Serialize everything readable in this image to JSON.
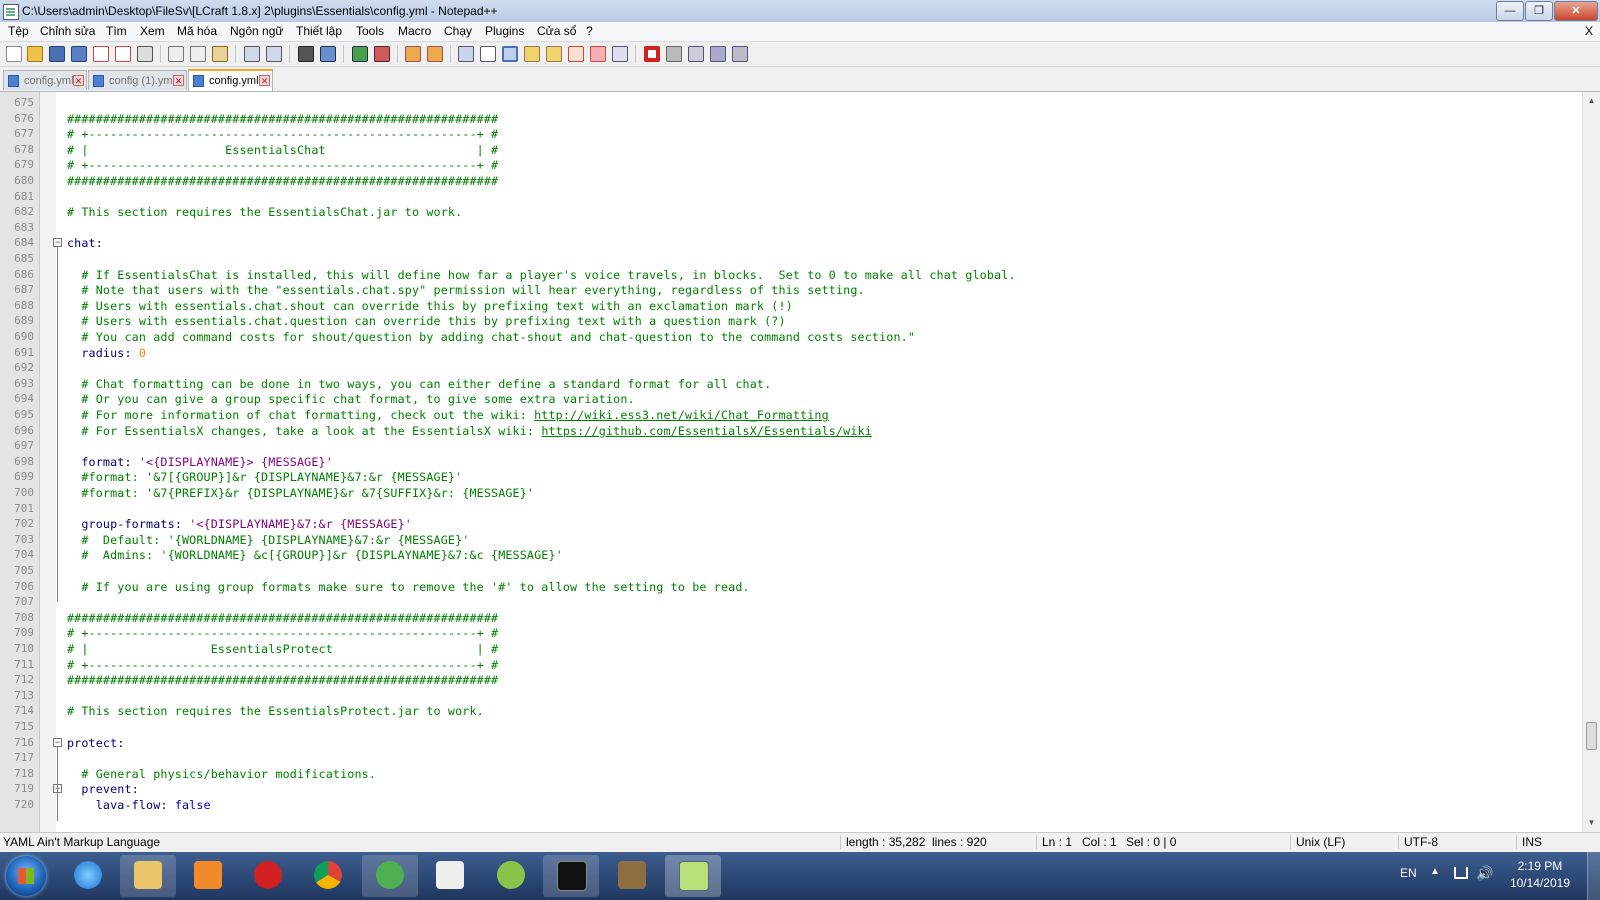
{
  "window": {
    "title": "C:\\Users\\admin\\Desktop\\FileSv\\[LCraft 1.8.x] 2\\plugins\\Essentials\\config.yml - Notepad++",
    "minimize_label": "—",
    "maximize_label": "❐",
    "close_label": "✕"
  },
  "menu": [
    {
      "label": "Tệp"
    },
    {
      "label": "Chỉnh sửa"
    },
    {
      "label": "Tìm"
    },
    {
      "label": "Xem"
    },
    {
      "label": "Mã hóa"
    },
    {
      "label": "Ngôn ngữ"
    },
    {
      "label": "Thiết lập"
    },
    {
      "label": "Tools"
    },
    {
      "label": "Macro"
    },
    {
      "label": "Chạy"
    },
    {
      "label": "Plugins"
    },
    {
      "label": "Cửa sổ"
    },
    {
      "label": "?"
    }
  ],
  "menu_close": "X",
  "tabs": [
    {
      "label": "config.yml",
      "active": false
    },
    {
      "label": "config (1).yml",
      "active": false
    },
    {
      "label": "config.yml",
      "active": true
    }
  ],
  "tab_close_glyph": "✕",
  "editor": {
    "lines": [
      {
        "n": "675",
        "segs": []
      },
      {
        "n": "676",
        "segs": [
          {
            "t": "############################################################",
            "c": "comment"
          }
        ]
      },
      {
        "n": "677",
        "segs": [
          {
            "t": "# +------------------------------------------------------+ #",
            "c": "comment"
          }
        ]
      },
      {
        "n": "678",
        "segs": [
          {
            "t": "# |                   EssentialsChat                     | #",
            "c": "comment"
          }
        ]
      },
      {
        "n": "679",
        "segs": [
          {
            "t": "# +------------------------------------------------------+ #",
            "c": "comment"
          }
        ]
      },
      {
        "n": "680",
        "segs": [
          {
            "t": "############################################################",
            "c": "comment"
          }
        ]
      },
      {
        "n": "681",
        "segs": []
      },
      {
        "n": "682",
        "segs": [
          {
            "t": "# This section requires the EssentialsChat.jar to work.",
            "c": "comment"
          }
        ]
      },
      {
        "n": "683",
        "segs": []
      },
      {
        "n": "684",
        "fold": "open",
        "segs": [
          {
            "t": "chat",
            "c": "key"
          },
          {
            "t": ":",
            "c": "key"
          }
        ]
      },
      {
        "n": "685",
        "segs": []
      },
      {
        "n": "686",
        "segs": [
          {
            "t": "  # If EssentialsChat is installed, this will define how far a player's voice travels, in blocks.  Set to 0 to make all chat global.",
            "c": "comment"
          }
        ]
      },
      {
        "n": "687",
        "segs": [
          {
            "t": "  # Note that users with the \"essentials.chat.spy\" permission will hear everything, regardless of this setting.",
            "c": "comment"
          }
        ]
      },
      {
        "n": "688",
        "segs": [
          {
            "t": "  # Users with essentials.chat.shout can override this by prefixing text with an exclamation mark (!)",
            "c": "comment"
          }
        ]
      },
      {
        "n": "689",
        "segs": [
          {
            "t": "  # Users with essentials.chat.question can override this by prefixing text with a question mark (?)",
            "c": "comment"
          }
        ]
      },
      {
        "n": "690",
        "segs": [
          {
            "t": "  # You can add command costs for shout/question by adding chat-shout and chat-question to the command costs section.\"",
            "c": "comment"
          }
        ]
      },
      {
        "n": "691",
        "segs": [
          {
            "t": "  radius",
            "c": "key"
          },
          {
            "t": ": ",
            "c": "key"
          },
          {
            "t": "0",
            "c": "num"
          }
        ]
      },
      {
        "n": "692",
        "segs": []
      },
      {
        "n": "693",
        "segs": [
          {
            "t": "  # Chat formatting can be done in two ways, you can either define a standard format for all chat.",
            "c": "comment"
          }
        ]
      },
      {
        "n": "694",
        "segs": [
          {
            "t": "  # Or you can give a group specific chat format, to give some extra variation.",
            "c": "comment"
          }
        ]
      },
      {
        "n": "695",
        "segs": [
          {
            "t": "  # For more information of chat formatting, check out the wiki: ",
            "c": "comment"
          },
          {
            "t": "http://wiki.ess3.net/wiki/Chat_Formatting",
            "c": "link"
          }
        ]
      },
      {
        "n": "696",
        "segs": [
          {
            "t": "  # For EssentialsX changes, take a look at the EssentialsX wiki: ",
            "c": "comment"
          },
          {
            "t": "https://github.com/EssentialsX/Essentials/wiki",
            "c": "link"
          }
        ]
      },
      {
        "n": "697",
        "segs": []
      },
      {
        "n": "698",
        "segs": [
          {
            "t": "  format",
            "c": "key"
          },
          {
            "t": ": ",
            "c": "key"
          },
          {
            "t": "'<{DISPLAYNAME}> {MESSAGE}'",
            "c": "str"
          }
        ]
      },
      {
        "n": "699",
        "segs": [
          {
            "t": "  #format: '&7[{GROUP}]&r {DISPLAYNAME}&7:&r {MESSAGE}'",
            "c": "comment"
          }
        ]
      },
      {
        "n": "700",
        "segs": [
          {
            "t": "  #format: '&7{PREFIX}&r {DISPLAYNAME}&r &7{SUFFIX}&r: {MESSAGE}'",
            "c": "comment"
          }
        ]
      },
      {
        "n": "701",
        "segs": []
      },
      {
        "n": "702",
        "segs": [
          {
            "t": "  group-formats",
            "c": "key"
          },
          {
            "t": ": ",
            "c": "key"
          },
          {
            "t": "'<{DISPLAYNAME}&7:&r {MESSAGE}'",
            "c": "str"
          }
        ]
      },
      {
        "n": "703",
        "segs": [
          {
            "t": "  #  Default: '{WORLDNAME} {DISPLAYNAME}&7:&r {MESSAGE}'",
            "c": "comment"
          }
        ]
      },
      {
        "n": "704",
        "segs": [
          {
            "t": "  #  Admins: '{WORLDNAME} &c[{GROUP}]&r {DISPLAYNAME}&7:&c {MESSAGE}'",
            "c": "comment"
          }
        ]
      },
      {
        "n": "705",
        "segs": []
      },
      {
        "n": "706",
        "segs": [
          {
            "t": "  # If you are using group formats make sure to remove the '#' to allow the setting to be read.",
            "c": "comment"
          }
        ]
      },
      {
        "n": "707",
        "segs": []
      },
      {
        "n": "708",
        "segs": [
          {
            "t": "############################################################",
            "c": "comment"
          }
        ]
      },
      {
        "n": "709",
        "segs": [
          {
            "t": "# +------------------------------------------------------+ #",
            "c": "comment"
          }
        ]
      },
      {
        "n": "710",
        "segs": [
          {
            "t": "# |                 EssentialsProtect                    | #",
            "c": "comment"
          }
        ]
      },
      {
        "n": "711",
        "segs": [
          {
            "t": "# +------------------------------------------------------+ #",
            "c": "comment"
          }
        ]
      },
      {
        "n": "712",
        "segs": [
          {
            "t": "############################################################",
            "c": "comment"
          }
        ]
      },
      {
        "n": "713",
        "segs": []
      },
      {
        "n": "714",
        "segs": [
          {
            "t": "# This section requires the EssentialsProtect.jar to work.",
            "c": "comment"
          }
        ]
      },
      {
        "n": "715",
        "segs": []
      },
      {
        "n": "716",
        "fold": "open",
        "segs": [
          {
            "t": "protect",
            "c": "key"
          },
          {
            "t": ":",
            "c": "key"
          }
        ]
      },
      {
        "n": "717",
        "segs": []
      },
      {
        "n": "718",
        "segs": [
          {
            "t": "  # General physics/behavior modifications.",
            "c": "comment"
          }
        ]
      },
      {
        "n": "719",
        "fold": "open",
        "segs": [
          {
            "t": "  prevent",
            "c": "key"
          },
          {
            "t": ":",
            "c": "key"
          }
        ]
      },
      {
        "n": "720",
        "segs": [
          {
            "t": "    lava-flow",
            "c": "key"
          },
          {
            "t": ": ",
            "c": "key"
          },
          {
            "t": "false",
            "c": "bool"
          }
        ]
      }
    ]
  },
  "status": {
    "language": "YAML Ain't Markup Language",
    "length": "length : 35,282",
    "lines": "lines : 920",
    "ln": "Ln : 1",
    "col": "Col : 1",
    "sel": "Sel : 0 | 0",
    "eol": "Unix (LF)",
    "encoding": "UTF-8",
    "mode": "INS"
  },
  "taskbar": {
    "lang": "EN",
    "time": "2:19 PM",
    "date": "10/14/2019"
  },
  "colors": {
    "comment": "#008000",
    "key": "#00007f",
    "string": "#7f007f",
    "number": "#ff8000",
    "accent_tab": "#f9a825"
  }
}
